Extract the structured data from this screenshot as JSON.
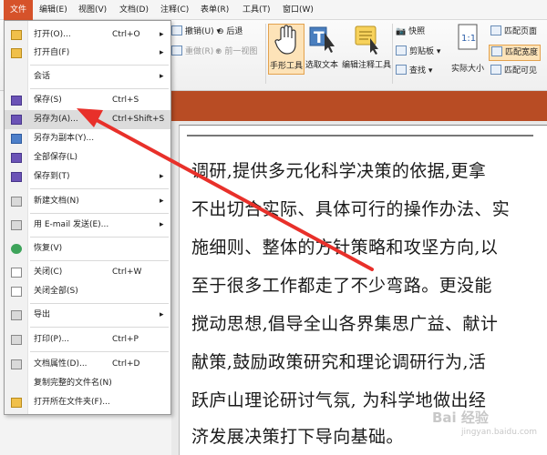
{
  "menubar": {
    "items": [
      {
        "label": "文件"
      },
      {
        "label": "编辑(E)"
      },
      {
        "label": "视图(V)"
      },
      {
        "label": "文档(D)"
      },
      {
        "label": "注释(C)"
      },
      {
        "label": "表单(R)"
      },
      {
        "label": "工具(T)"
      },
      {
        "label": "窗口(W)"
      }
    ]
  },
  "ribbon": {
    "undo": "撤销(U)",
    "back": "后退",
    "redo": "重做(R)",
    "forward": "前一视图",
    "hand_tool": "手形工具",
    "select_text": "选取文本",
    "edit_annot": "编辑注释工具",
    "snapshot": "快照",
    "clipboard": "剪贴板",
    "find": "查找",
    "actual_size": "实际大小",
    "fit_page": "匹配页面",
    "fit_width": "匹配宽度",
    "fit_visible": "匹配可见"
  },
  "file_menu": {
    "items": [
      {
        "label": "打开(O)...",
        "shortcut": "Ctrl+O",
        "arrow": "▸"
      },
      {
        "label": "打开自(F)",
        "shortcut": "",
        "arrow": "▸"
      },
      {
        "label": "会话",
        "shortcut": "",
        "arrow": "▸"
      },
      {
        "label": "保存(S)",
        "shortcut": "Ctrl+S",
        "arrow": ""
      },
      {
        "label": "另存为(A)...",
        "shortcut": "Ctrl+Shift+S",
        "arrow": ""
      },
      {
        "label": "另存为副本(Y)...",
        "shortcut": "",
        "arrow": ""
      },
      {
        "label": "全部保存(L)",
        "shortcut": "",
        "arrow": ""
      },
      {
        "label": "保存到(T)",
        "shortcut": "",
        "arrow": "▸"
      },
      {
        "label": "新建文档(N)",
        "shortcut": "",
        "arrow": "▸"
      },
      {
        "label": "用 E-mail 发送(E)...",
        "shortcut": "",
        "arrow": "▸"
      },
      {
        "label": "恢复(V)",
        "shortcut": "",
        "arrow": ""
      },
      {
        "label": "关闭(C)",
        "shortcut": "Ctrl+W",
        "arrow": ""
      },
      {
        "label": "关闭全部(S)",
        "shortcut": "",
        "arrow": ""
      },
      {
        "label": "导出",
        "shortcut": "",
        "arrow": "▸"
      },
      {
        "label": "打印(P)...",
        "shortcut": "Ctrl+P",
        "arrow": ""
      },
      {
        "label": "文档属性(D)...",
        "shortcut": "Ctrl+D",
        "arrow": ""
      },
      {
        "label": "复制完整的文件名(N)",
        "shortcut": "",
        "arrow": ""
      },
      {
        "label": "打开所在文件夹(F)...",
        "shortcut": "",
        "arrow": ""
      }
    ]
  },
  "document": {
    "lines": [
      "调研,提供多元化科学决策的依据,更拿",
      "不出切合实际、具体可行的操作办法、实",
      "施细则、整体的方针策略和攻坚方向,以",
      "至于很多工作都走了不少弯路。更没能",
      "搅动思想,倡导全山各界集思广益、献计",
      "献策,鼓励政策研究和理论调研行为,活",
      "跃庐山理论研讨气氛, 为科学地做出经",
      "济发展决策打下导向基础。"
    ]
  },
  "watermark": {
    "text": "Bai 经验",
    "sub": "jingyan.baidu.com"
  },
  "colors": {
    "accent": "#d6522a",
    "tab_strip": "#b84c24",
    "annotation_arrow": "#e8302a"
  }
}
